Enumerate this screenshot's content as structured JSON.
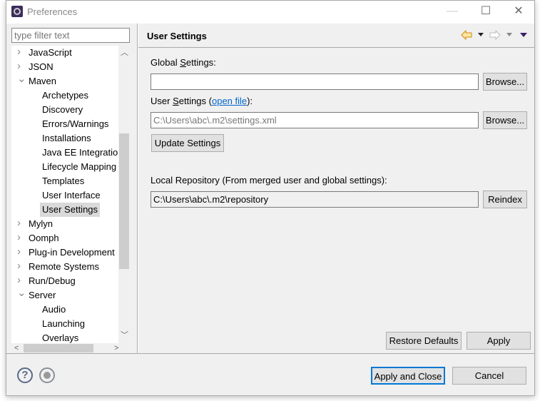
{
  "window": {
    "title": "Preferences",
    "minimize": "—",
    "maximize": "☐",
    "close": "✕"
  },
  "filter": {
    "placeholder": "type filter text"
  },
  "tree": [
    {
      "label": "JavaScript",
      "level": 0,
      "state": "collapsed"
    },
    {
      "label": "JSON",
      "level": 0,
      "state": "collapsed"
    },
    {
      "label": "Maven",
      "level": 0,
      "state": "expanded"
    },
    {
      "label": "Archetypes",
      "level": 1
    },
    {
      "label": "Discovery",
      "level": 1
    },
    {
      "label": "Errors/Warnings",
      "level": 1
    },
    {
      "label": "Installations",
      "level": 1
    },
    {
      "label": "Java EE Integration",
      "level": 1
    },
    {
      "label": "Lifecycle Mapping",
      "level": 1
    },
    {
      "label": "Templates",
      "level": 1
    },
    {
      "label": "User Interface",
      "level": 1
    },
    {
      "label": "User Settings",
      "level": 1,
      "selected": true
    },
    {
      "label": "Mylyn",
      "level": 0,
      "state": "collapsed"
    },
    {
      "label": "Oomph",
      "level": 0,
      "state": "collapsed"
    },
    {
      "label": "Plug-in Development",
      "level": 0,
      "state": "collapsed"
    },
    {
      "label": "Remote Systems",
      "level": 0,
      "state": "collapsed"
    },
    {
      "label": "Run/Debug",
      "level": 0,
      "state": "collapsed"
    },
    {
      "label": "Server",
      "level": 0,
      "state": "expanded"
    },
    {
      "label": "Audio",
      "level": 1
    },
    {
      "label": "Launching",
      "level": 1
    },
    {
      "label": "Overlays",
      "level": 1
    }
  ],
  "page": {
    "title": "User Settings",
    "global_label_pre": "Global ",
    "global_label_u": "S",
    "global_label_post": "ettings:",
    "global_value": "",
    "browse": "Browse...",
    "user_label_pre": "User ",
    "user_label_u": "S",
    "user_label_post": "ettings (",
    "open_file": "open file",
    "user_label_end": "):",
    "user_value": "C:\\Users\\abc\\.m2\\settings.xml",
    "update": "Update Settings",
    "local_label": "Local Repository (From merged user and global settings):",
    "local_value": "C:\\Users\\abc\\.m2\\repository",
    "reindex": "Reindex",
    "restore": "Restore Defaults",
    "apply": "Apply"
  },
  "footer": {
    "apply_close": "Apply and Close",
    "cancel": "Cancel",
    "help": "?"
  },
  "colors": {
    "link": "#0066cc",
    "back_arrow": "#e0a020",
    "selected_bg": "#d9d9d9"
  }
}
